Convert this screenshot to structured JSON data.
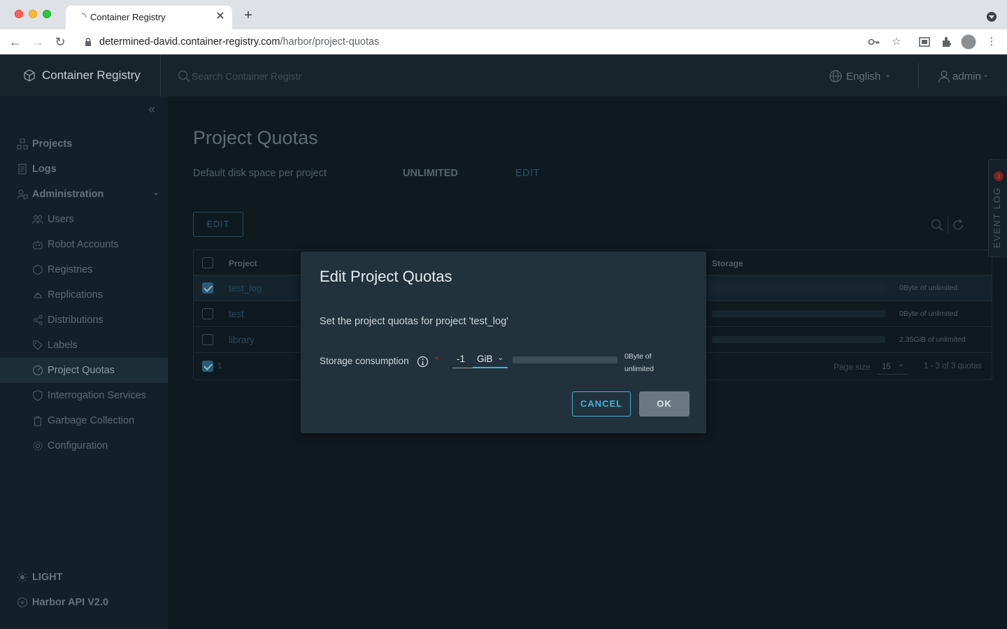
{
  "browser": {
    "tab_title": "Container Registry",
    "url_host": "determined-david.container-registry.com",
    "url_path": "/harbor/project-quotas"
  },
  "header": {
    "brand": "Container Registry",
    "search_placeholder": "Search Container Registr",
    "language": "English",
    "user": "admin"
  },
  "sidebar": {
    "projects": "Projects",
    "logs": "Logs",
    "administration": "Administration",
    "admin_items": [
      "Users",
      "Robot Accounts",
      "Registries",
      "Replications",
      "Distributions",
      "Labels",
      "Project Quotas",
      "Interrogation Services",
      "Garbage Collection",
      "Configuration"
    ],
    "theme": "LIGHT",
    "api": "Harbor API V2.0"
  },
  "page": {
    "title": "Project Quotas",
    "default_label": "Default disk space per project",
    "default_value": "UNLIMITED",
    "default_edit": "EDIT",
    "edit_button": "EDIT"
  },
  "grid": {
    "col_project": "Project",
    "col_storage": "Storage",
    "rows": [
      {
        "name": "test_log",
        "storage": "0Byte of unlimited",
        "selected": true
      },
      {
        "name": "test",
        "storage": "0Byte of unlimited",
        "selected": false
      },
      {
        "name": "library",
        "storage": "2.35GiB of unlimited",
        "selected": false
      }
    ],
    "selected_count": "1",
    "page_size_label": "Page size",
    "page_size": "15",
    "range": "1 - 3 of 3 quotas"
  },
  "event_log": {
    "label": "EVENT LOG",
    "badge": "3"
  },
  "modal": {
    "title": "Edit Project Quotas",
    "description": "Set the project quotas for project 'test_log'",
    "storage_label": "Storage consumption",
    "required_mark": "*",
    "quota_value": "-1",
    "unit": "GiB",
    "usage_line1": "0Byte of",
    "usage_line2": "unlimited",
    "usage_fraction": 0,
    "cancel": "CANCEL",
    "ok": "OK"
  },
  "colors": {
    "accent": "#49afd9",
    "required": "#c92100",
    "modal_bg": "#21323c"
  }
}
